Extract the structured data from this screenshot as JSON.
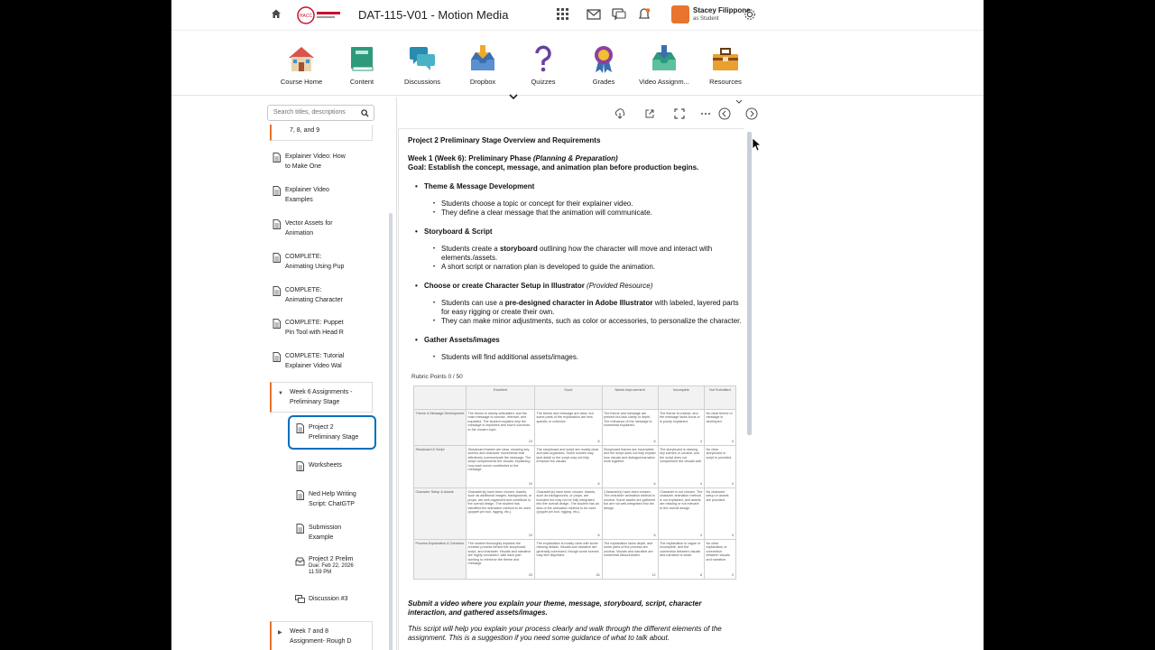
{
  "header": {
    "course_title": "DAT-115-V01 - Motion Media",
    "user_name": "Stacey Filippone",
    "user_role": "as Student",
    "accent": "#e8742d"
  },
  "nav": [
    {
      "label": "Course Home",
      "icon": "house-icon"
    },
    {
      "label": "Content",
      "icon": "book-icon"
    },
    {
      "label": "Discussions",
      "icon": "chat-icon"
    },
    {
      "label": "Dropbox",
      "icon": "inbox-icon"
    },
    {
      "label": "Quizzes",
      "icon": "question-icon"
    },
    {
      "label": "Grades",
      "icon": "ribbon-icon"
    },
    {
      "label": "Video Assignm...",
      "icon": "video-inbox-icon"
    },
    {
      "label": "Resources",
      "icon": "toolbox-icon"
    }
  ],
  "toc": {
    "search_placeholder": "Search titles, descriptions",
    "partial_item": "7, 8, and 9",
    "items": [
      {
        "l1": "Explainer Video: How",
        "l2": "to Make One"
      },
      {
        "l1": "Explainer Video",
        "l2": "Examples"
      },
      {
        "l1": "Vector Assets for",
        "l2": "Animation"
      },
      {
        "l1": "COMPLETE:",
        "l2": "Animating Using Pup"
      },
      {
        "l1": "COMPLETE:",
        "l2": "Animating Character"
      },
      {
        "l1": "COMPLETE: Puppet",
        "l2": "Pin Tool with Head R"
      },
      {
        "l1": "COMPLETE: Tutorial",
        "l2": "Explainer Video Wal"
      }
    ],
    "module": {
      "l1": "Week 6 Assignments -",
      "l2": "Preliminary Stage"
    },
    "sub": [
      {
        "l1": "Project 2",
        "l2": "Preliminary Stage"
      },
      {
        "l1": "Worksheets",
        "l2": ""
      },
      {
        "l1": "Ned Help Writing",
        "l2": "Script: ChatGTP"
      },
      {
        "l1": "Submission",
        "l2": "Example"
      }
    ],
    "assignment": {
      "l1": "Project 2 Prelim",
      "due": "Due: Feb 22, 2026",
      "time": "11:59 PM"
    },
    "discussion": "Discussion #3",
    "next_module": {
      "l1": "Week 7 and 8",
      "l2": "Assignment- Rough D"
    }
  },
  "doc": {
    "title": "Project 2 Preliminary Stage Overview and Requirements",
    "week_label": "Week 1 (Week 6): Preliminary Phase ",
    "week_italic": "(Planning & Preparation)",
    "goal": "Goal: Establish the concept, message, and animation plan before production begins.",
    "s1": "Theme & Message Development",
    "s1a": "Students choose a topic or concept for their explainer video.",
    "s1b": "They define a clear message that the animation will communicate.",
    "s2": "Storyboard & Script",
    "s2a_pre": "Students create a ",
    "s2a_bold": "storyboard",
    "s2a_post": " outlining how the character will move and interact with elements./assets.",
    "s2b": "A short script or narration plan is developed to guide the animation.",
    "s3": "Choose or create Character Setup in Illustrator ",
    "s3_italic": "(Provided Resource)",
    "s3a_pre": "Students can use a ",
    "s3a_bold": "pre-designed character in Adobe Illustrator",
    "s3a_post": " with labeled, layered parts for easy rigging or create their own.",
    "s3b": "They can make minor adjustments, such as color or accessories, to personalize the character.",
    "s4": "Gather Assets/images",
    "s4a": "Students will find additional assets/images.",
    "rubric_title": "Rubric Points 0 / 50",
    "closing": "Submit a video where you explain your theme, message, storyboard, script, character interaction, and gathered assets/images.",
    "closing2": "This script will help you explain your process clearly and walk through the different elements of the assignment. This is a suggestion if you need some guidance of what to talk about."
  },
  "rubric": {
    "levels": [
      "Excellent",
      "Good",
      "Needs Improvement",
      "Incomplete",
      "Not Submitted"
    ],
    "rows": [
      {
        "criterion": "Theme & Message Development",
        "cells": [
          "The theme is clearly articulated, and the main message is concise, relevant, and impactful. The student explains why the message is important and how it connects to the chosen topic.",
          "The theme and message are clear, but some parts of the explanation are less specific or cohesive.",
          "The theme and message are present but lack clarity or depth. The relevance of the message is somewhat explained.",
          "The theme is unclear, and the message lacks focus or is poorly explained.",
          "No clear theme or message is developed."
        ],
        "points": [
          "10",
          "8",
          "6",
          "4",
          "0"
        ]
      },
      {
        "criterion": "Storyboard & Script",
        "cells": [
          "Storyboard frames are clear, showing key scenes and character movements that effectively communicate the message. The script complements the visuals, explaining how each scene contributes to the message.",
          "The storyboard and script are mostly clear and well-organized. Some scenes may lack detail or the script may not fully enhance the visuals.",
          "Storyboard frames are incomplete, and the script does not fully explain how visuals and dialogue/narration work together.",
          "The storyboard is missing key scenes or unclear, and the script does not complement the visuals well.",
          "No clear storyboard or script is provided."
        ],
        "points": [
          "10",
          "8",
          "6",
          "4",
          "0"
        ]
      },
      {
        "criterion": "Character Setup & Assets",
        "cells": [
          "Character(s) have been chosen. Assets, such as additional images, backgrounds, or props, are well-organized and contribute to the overall design. The student has identified the animation method to be used (puppet pin tool, rigging, etc.).",
          "Character(s) have been chosen. Assets, such as backgrounds, or props, are included but may not be fully integrated into the overall design. The student has an idea of the animation method to be used (puppet pin tool, rigging, etc.).",
          "Character(s) have been chosen. The character animation method is unclear. Some assets are gathered but are not well-integrated into the design.",
          "Character is not chosen. The character animation method is not explained, and assets are missing or not relevant to the overall design.",
          "No character setup or assets are provided."
        ],
        "points": [
          "10",
          "8",
          "6",
          "4",
          "0"
        ]
      },
      {
        "criterion": "Process Explanation & Cohesion",
        "cells": [
          "The student thoroughly explains the creative process behind the storyboard, script, and character. Visuals and narrative are highly connected, with each part working to reinforce the theme and message.",
          "The explanation is mostly clear with some missing details. Visuals and narrative are generally connected, though some scenes may feel disjointed.",
          "The explanation lacks depth, and some parts of the process are unclear. Visuals and narrative are somewhat disconnected.",
          "The explanation is vague or incomplete, and the connection between visuals and narrative is weak.",
          "No clear explanation or connection between visuals and narrative."
        ],
        "points": [
          "20",
          "16",
          "12",
          "8",
          "0"
        ]
      }
    ]
  }
}
